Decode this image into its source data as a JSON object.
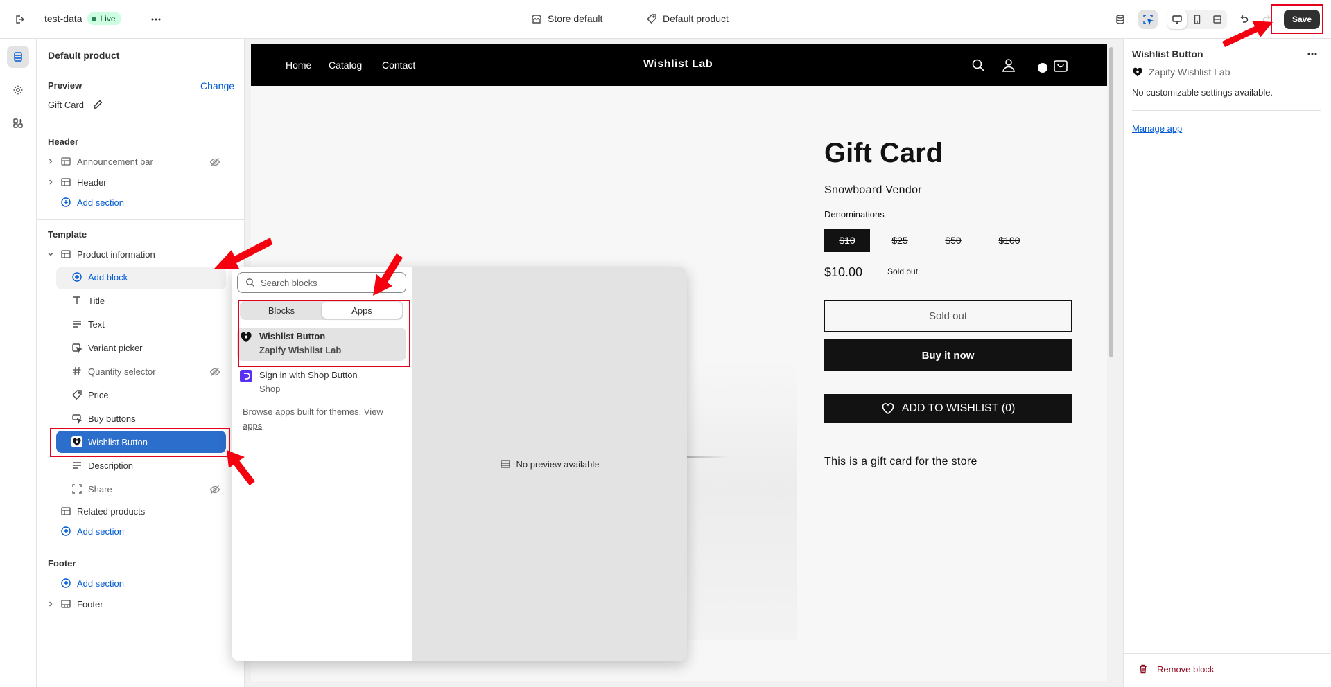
{
  "topbar": {
    "store_name": "test-data",
    "status": "Live",
    "store_default": "Store default",
    "template": "Default product",
    "save_label": "Save"
  },
  "sidebar": {
    "title": "Default product",
    "preview_label": "Preview",
    "change_label": "Change",
    "preview_product": "Gift Card",
    "header_group": "Header",
    "header_items": [
      "Announcement bar",
      "Header"
    ],
    "add_section": "Add section",
    "template_group": "Template",
    "product_information": "Product information",
    "add_block": "Add block",
    "blocks": [
      "Title",
      "Text",
      "Variant picker",
      "Quantity selector",
      "Price",
      "Buy buttons",
      "Wishlist Button",
      "Description",
      "Share"
    ],
    "related_products": "Related products",
    "footer_group": "Footer",
    "footer_item": "Footer"
  },
  "store": {
    "nav": [
      "Home",
      "Catalog",
      "Contact"
    ],
    "brand": "Wishlist Lab",
    "product_title": "Gift Card",
    "vendor": "Snowboard Vendor",
    "denominations_label": "Denominations",
    "denominations": [
      "$10",
      "$25",
      "$50",
      "$100"
    ],
    "price": "$10.00",
    "sold_out_badge": "Sold out",
    "sold_out_button": "Sold out",
    "buy_now": "Buy it now",
    "wishlist": "ADD TO WISHLIST (0)",
    "description": "This is a gift card for the store"
  },
  "popover": {
    "search_placeholder": "Search blocks",
    "tabs": [
      "Blocks",
      "Apps"
    ],
    "apps": [
      {
        "name": "Wishlist Button",
        "vendor": "Zapify Wishlist Lab"
      },
      {
        "name": "Sign in with Shop Button",
        "vendor": "Shop"
      }
    ],
    "browse_text": "Browse apps built for themes.",
    "view_apps": "View apps",
    "no_preview": "No preview available"
  },
  "right_panel": {
    "title": "Wishlist Button",
    "app_name": "Zapify Wishlist Lab",
    "note": "No customizable settings available.",
    "manage_app": "Manage app",
    "remove_block": "Remove block"
  },
  "colors": {
    "accent": "#005bd3",
    "selected": "#2c6ecb",
    "annotation": "#e5001b",
    "remove": "#8e0b21"
  }
}
